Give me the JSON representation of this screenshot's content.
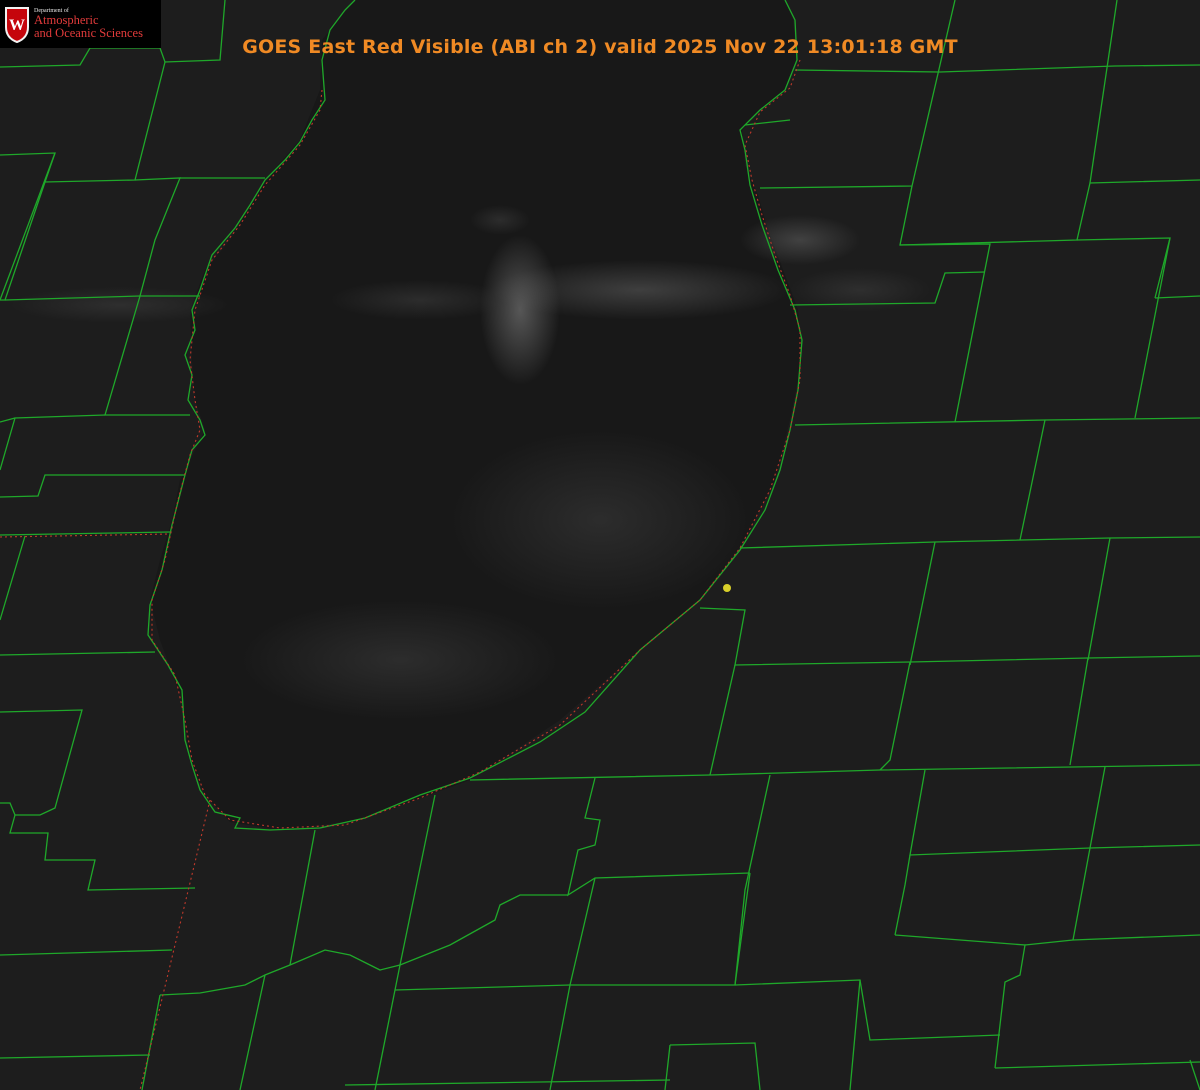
{
  "title": "GOES East Red Visible (ABI ch 2) valid 2025 Nov 22 13:01:18 GMT",
  "logo": {
    "department": "Department of",
    "line1": "Atmospheric",
    "line2": "and Oceanic Sciences",
    "crest_letter": "W"
  },
  "colors": {
    "title": "#f08a24",
    "county_lines": "#1fa82a",
    "state_line": "#c0392b",
    "station_marker": "#d8cf2a",
    "logo_text": "#e23b3b"
  },
  "layers": [
    "visible-satellite-imagery",
    "county-boundaries",
    "state-boundaries",
    "lake-shoreline",
    "station-marker"
  ]
}
